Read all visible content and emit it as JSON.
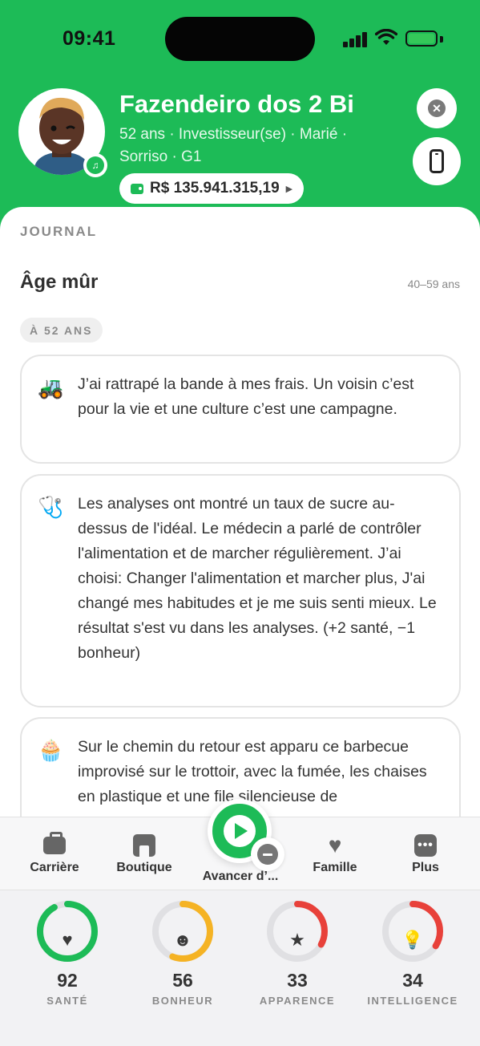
{
  "status_bar": {
    "time": "09:41"
  },
  "profile": {
    "name": "Fazendeiro dos 2 Bi",
    "meta_line1": "52 ans · Investisseur(se) · Marié ·",
    "meta_line2": "Sorriso · G1",
    "balance": "R$ 135.941.315,19"
  },
  "journal": {
    "header": "JOURNAL",
    "stage_title": "Âge mûr",
    "stage_range": "40–59 ans",
    "age_pill": "À 52 ANS",
    "entries": [
      {
        "icon": "farm-icon",
        "emoji": "🚜",
        "text": "J’ai rattrapé la bande à mes frais. Un voisin c’est pour la vie et une culture c’est une campagne."
      },
      {
        "icon": "stethoscope-icon",
        "emoji": "🩺",
        "text": "Les analyses ont montré un taux de sucre au-dessus de l'idéal. Le médecin a parlé de contrôler l'alimentation et de marcher régulièrement. J’ai choisi: Changer l'alimentation et marcher plus, J'ai changé mes habitudes et je me suis senti mieux. Le résultat s'est vu dans les analyses. (+2 santé, −1 bonheur)"
      },
      {
        "icon": "cupcake-icon",
        "emoji": "🧁",
        "text": "Sur le chemin du retour est apparu ce barbecue improvisé sur le trottoir, avec la fumée, les chaises en plastique et une file silencieuse de"
      }
    ]
  },
  "tabs": {
    "career": "Carrière",
    "shop": "Boutique",
    "advance": "Avancer d’...",
    "family": "Famille",
    "more": "Plus"
  },
  "stats": [
    {
      "label": "SANTÉ",
      "value": "92",
      "level": 0.92,
      "color": "#1dbb57",
      "icon": "heart-icon"
    },
    {
      "label": "BONHEUR",
      "value": "56",
      "level": 0.56,
      "color": "#f5b324",
      "icon": "smile-icon"
    },
    {
      "label": "APPARENCE",
      "value": "33",
      "level": 0.33,
      "color": "#e8413a",
      "icon": "star-icon"
    },
    {
      "label": "INTELLIGENCE",
      "value": "34",
      "level": 0.34,
      "color": "#e8413a",
      "icon": "bulb-icon"
    }
  ]
}
